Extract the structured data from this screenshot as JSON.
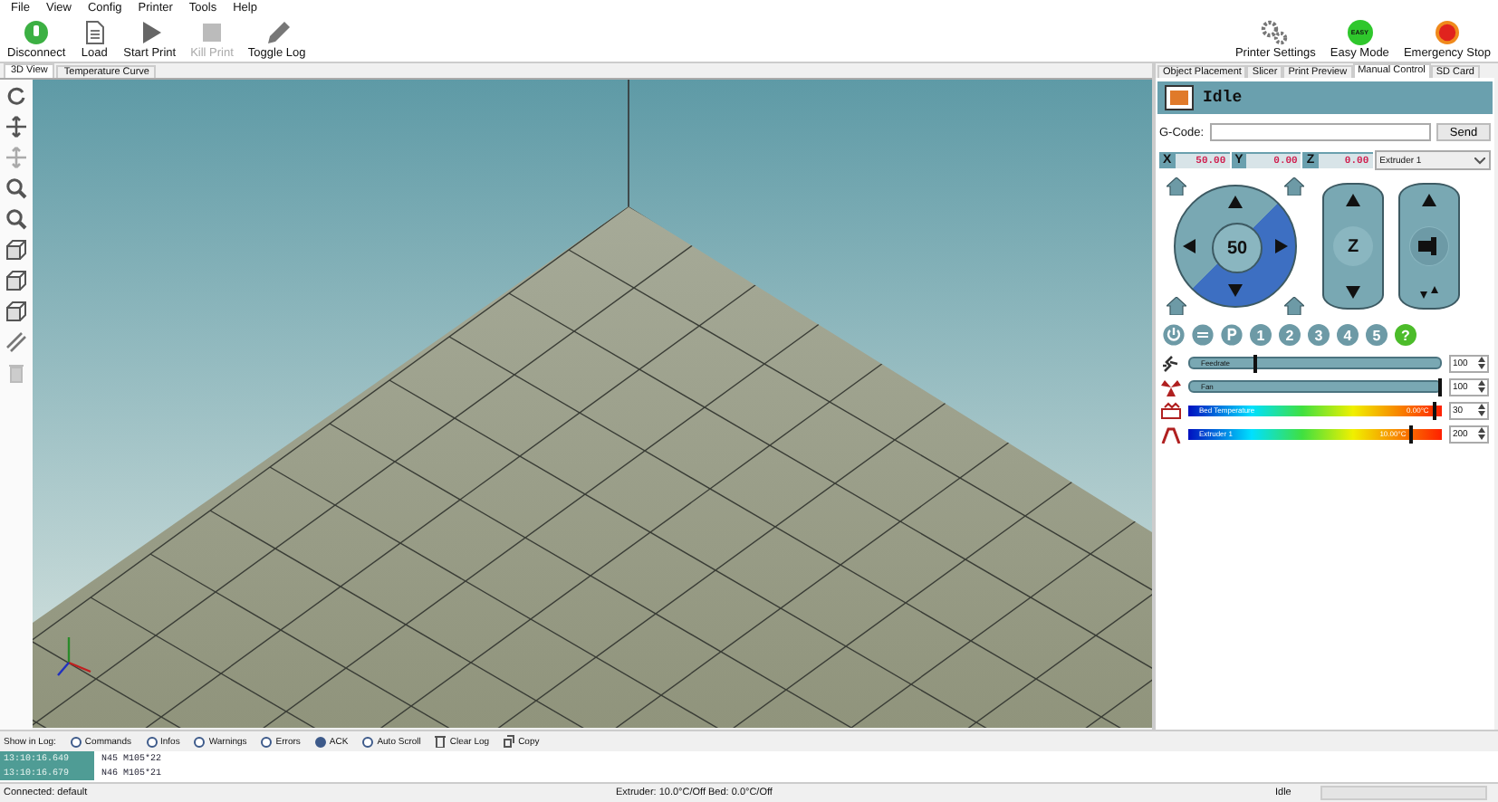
{
  "menu": [
    "File",
    "View",
    "Config",
    "Printer",
    "Tools",
    "Help"
  ],
  "toolbar": [
    {
      "kind": "disconnect",
      "label": "Disconnect",
      "disabled": false
    },
    {
      "kind": "load",
      "label": "Load",
      "disabled": false
    },
    {
      "kind": "start",
      "label": "Start Print",
      "disabled": false
    },
    {
      "kind": "kill",
      "label": "Kill Print",
      "disabled": true
    },
    {
      "kind": "log",
      "label": "Toggle Log",
      "disabled": false
    }
  ],
  "toolbar_right": [
    {
      "kind": "settings",
      "label": "Printer Settings"
    },
    {
      "kind": "easy",
      "label": "Easy Mode",
      "badge": "EASY"
    },
    {
      "kind": "stop",
      "label": "Emergency Stop"
    }
  ],
  "view_tabs": [
    {
      "label": "3D View",
      "selected": true
    },
    {
      "label": "Temperature Curve",
      "selected": false
    }
  ],
  "side_tabs": [
    {
      "label": "Object Placement",
      "selected": false
    },
    {
      "label": "Slicer",
      "selected": false
    },
    {
      "label": "Print Preview",
      "selected": false
    },
    {
      "label": "Manual Control",
      "selected": true
    },
    {
      "label": "SD Card",
      "selected": false
    }
  ],
  "manual": {
    "status": "Idle",
    "gcode_label": "G-Code:",
    "send": "Send",
    "coords": [
      {
        "axis": "X",
        "value": "50.00"
      },
      {
        "axis": "Y",
        "value": "0.00"
      },
      {
        "axis": "Z",
        "value": "0.00"
      }
    ],
    "extruder_select": "Extruder 1",
    "xy_step": "50",
    "z_label": "Z",
    "number_buttons": [
      "1",
      "2",
      "3",
      "4",
      "5"
    ],
    "help": "?",
    "sliders": [
      {
        "kind": "slider",
        "label": "Feedrate",
        "level": 0.26,
        "value": "100"
      },
      {
        "kind": "slider",
        "label": "Fan",
        "level": 1.0,
        "value": "100"
      },
      {
        "kind": "temp",
        "label": "Bed Temperature",
        "reading": "0.00°C",
        "level": 0.97,
        "value": "30"
      },
      {
        "kind": "temp",
        "label": "Extruder 1",
        "reading": "10.00°C",
        "level": 0.88,
        "value": "200"
      }
    ]
  },
  "log": {
    "show_label": "Show in Log:",
    "filters": [
      {
        "label": "Commands",
        "checked": false
      },
      {
        "label": "Infos",
        "checked": false
      },
      {
        "label": "Warnings",
        "checked": false
      },
      {
        "label": "Errors",
        "checked": false
      },
      {
        "label": "ACK",
        "checked": true
      },
      {
        "label": "Auto Scroll",
        "checked": false
      }
    ],
    "clear": "Clear Log",
    "copy": "Copy",
    "rows": [
      {
        "time": "13:10:16.649",
        "text": "N45 M105*22"
      },
      {
        "time": "13:10:16.679",
        "text": "N46 M105*21"
      }
    ]
  },
  "status_bar": {
    "connection": "Connected: default",
    "temps": "Extruder: 10.0°C/Off Bed: 0.0°C/Off",
    "state": "Idle",
    "progress": {
      "level": 0
    }
  }
}
